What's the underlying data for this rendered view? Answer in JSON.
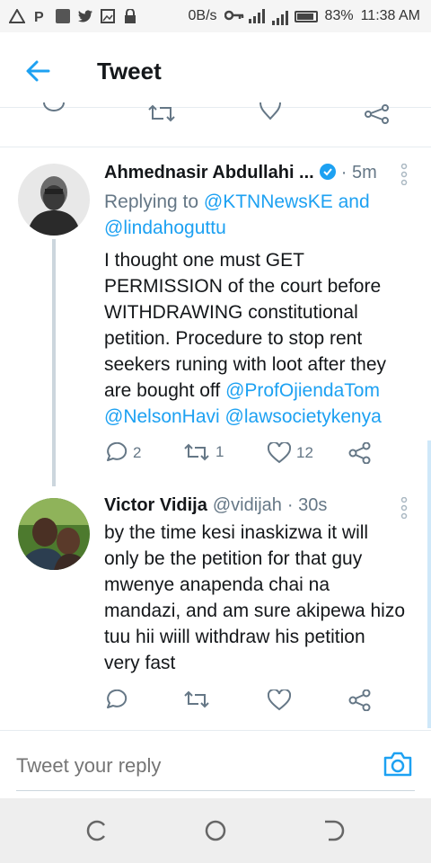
{
  "status_bar": {
    "network_speed": "0B/s",
    "battery": "83%",
    "time": "11:38 AM"
  },
  "app_bar": {
    "title": "Tweet"
  },
  "tweets": [
    {
      "name": "Ahmednasir Abdullahi ...",
      "time": "· 5m",
      "verified": true,
      "reply_prefix": "Replying to ",
      "reply_to_1": "@KTNNewsKE",
      "reply_and": " and",
      "reply_to_2": "@lindahoguttu",
      "body_line_1": "I thought one must GET",
      "body_line_2": "PERMISSION of the court before",
      "body_line_3": "WITHDRAWING constitutional",
      "body_line_4": "petition. Procedure to stop rent",
      "body_line_5": "seekers runing with loot after they",
      "body_line_6_text": "are bought off ",
      "mention_1": "@ProfOjiendaTom",
      "mention_2": "@NelsonHavi",
      "mention_3": "@lawsocietykenya",
      "replies": "2",
      "retweets": "1",
      "likes": "12"
    },
    {
      "name": "Victor Vidija",
      "handle": "@vidijah",
      "time": "· 30s",
      "body_line_1": "by the time kesi inaskizwa it will",
      "body_line_2": "only be the petition for that guy",
      "body_line_3": "mwenye anapenda chai na",
      "body_line_4": "mandazi, and am sure akipewa hizo",
      "body_line_5": "tuu hii wiill withdraw his petition",
      "body_line_6": "very fast"
    }
  ],
  "composer": {
    "placeholder": "Tweet your reply"
  },
  "colors": {
    "accent": "#1da1f2",
    "secondary_text": "#657786",
    "divider": "#e6ecf0"
  }
}
